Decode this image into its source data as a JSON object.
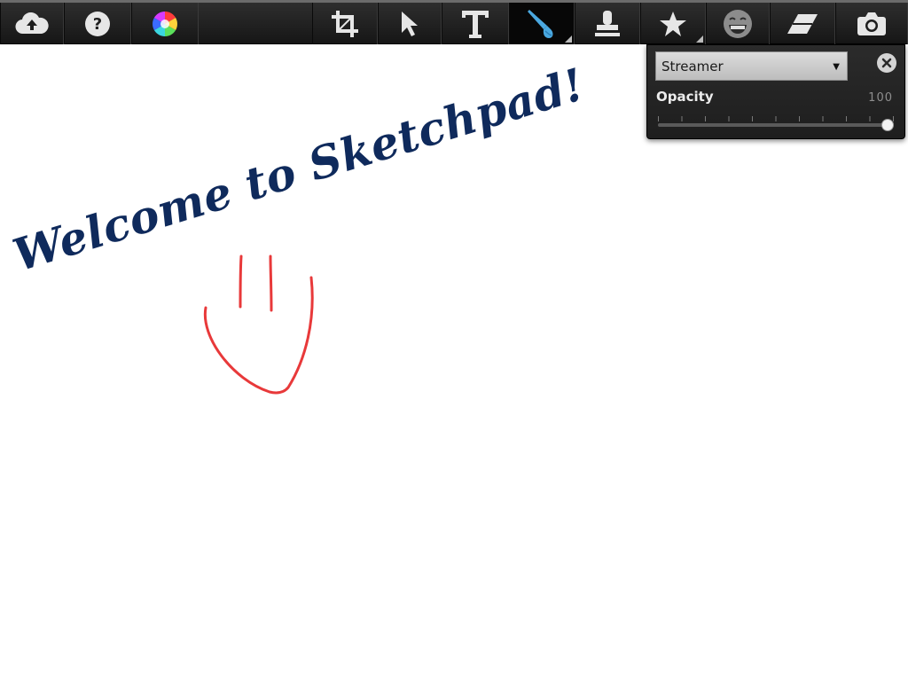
{
  "toolbar": {
    "tools": [
      {
        "name": "upload",
        "icon": "cloud-upload-icon"
      },
      {
        "name": "help",
        "icon": "question-icon"
      },
      {
        "name": "color",
        "icon": "color-wheel-icon"
      },
      {
        "name": "crop",
        "icon": "crop-icon"
      },
      {
        "name": "select",
        "icon": "pointer-icon"
      },
      {
        "name": "text",
        "icon": "text-icon"
      },
      {
        "name": "brush",
        "icon": "brush-icon",
        "active": true
      },
      {
        "name": "stamp",
        "icon": "stamp-icon"
      },
      {
        "name": "shape",
        "icon": "star-icon"
      },
      {
        "name": "emoji",
        "icon": "grin-icon"
      },
      {
        "name": "eraser",
        "icon": "eraser-icon"
      },
      {
        "name": "snapshot",
        "icon": "camera-icon"
      }
    ],
    "active_tool": "brush"
  },
  "brush_panel": {
    "brush_type": "Streamer",
    "opacity_label": "Opacity",
    "opacity_value": "100",
    "opacity_fraction": 1.0
  },
  "canvas": {
    "welcome_text": "Welcome to Sketchpad!",
    "text_color": "#0f2a5c",
    "stroke_color": "#e8393a"
  },
  "colors": {
    "accent": "#4aa8e0",
    "toolbar_bg": "#1e1e1e",
    "panel_bg": "#252525"
  }
}
